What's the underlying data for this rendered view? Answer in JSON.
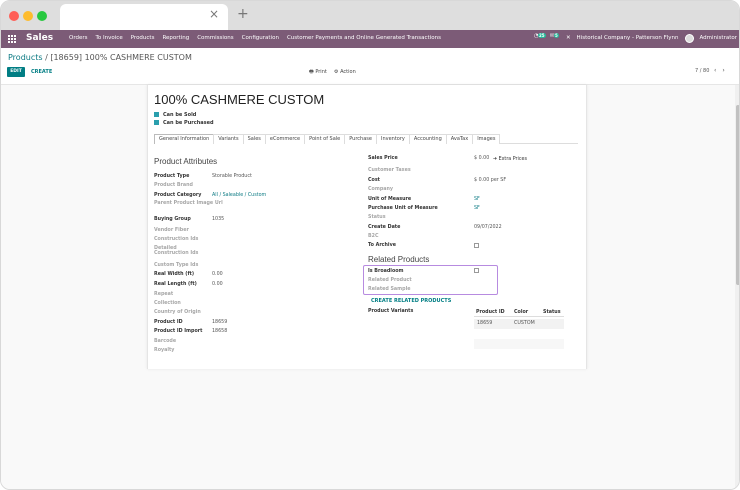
{
  "navbar": {
    "app_name": "Sales",
    "menu": [
      "Orders",
      "To Invoice",
      "Products",
      "Reporting",
      "Commissions",
      "Configuration",
      "Customer Payments and Online Generated Transactions"
    ],
    "activity_badge": "25",
    "messages_badge": "5",
    "company": "Historical Company - Patterson Flynn",
    "user": "Administrator"
  },
  "control": {
    "breadcrumb_root": "Products",
    "breadcrumb_current": "[18659] 100% CASHMERE CUSTOM",
    "edit_label": "EDIT",
    "create_label": "CREATE",
    "print_label": "Print",
    "action_label": "Action",
    "pager": "7 / 80"
  },
  "product": {
    "name": "100% CASHMERE CUSTOM",
    "can_be_sold_label": "Can be Sold",
    "can_be_purchased_label": "Can be Purchased",
    "can_be_sold": true,
    "can_be_purchased": true
  },
  "tabs": [
    "General Information",
    "Variants",
    "Sales",
    "eCommerce",
    "Point of Sale",
    "Purchase",
    "Inventory",
    "Accounting",
    "AvaTax",
    "Images"
  ],
  "left": {
    "section_title": "Product Attributes",
    "fields": [
      {
        "label": "Product Type",
        "value": "Storable Product",
        "muted": false,
        "link": false
      },
      {
        "label": "Product Brand",
        "value": "",
        "muted": true,
        "link": false
      },
      {
        "label": "Product Category",
        "value": "All / Saleable / Custom",
        "muted": false,
        "link": true
      },
      {
        "label": "Parent Product Image Url",
        "value": "",
        "muted": true,
        "link": false
      },
      {
        "label": "Buying Group",
        "value": "1035",
        "muted": false,
        "link": false
      },
      {
        "label": "Vendor Fiber",
        "value": "",
        "muted": true,
        "link": false
      },
      {
        "label": "Construction Ids",
        "value": "",
        "muted": true,
        "link": false
      },
      {
        "label": "Detailed Construction Ids",
        "value": "",
        "muted": true,
        "link": false
      },
      {
        "label": "Custom Type Ids",
        "value": "",
        "muted": true,
        "link": false
      },
      {
        "label": "Real Width (ft)",
        "value": "0.00",
        "muted": false,
        "link": false
      },
      {
        "label": "Real Length (ft)",
        "value": "0.00",
        "muted": false,
        "link": false
      },
      {
        "label": "Repeat",
        "value": "",
        "muted": true,
        "link": false
      },
      {
        "label": "Collection",
        "value": "",
        "muted": true,
        "link": false
      },
      {
        "label": "Country of Origin",
        "value": "",
        "muted": true,
        "link": false
      },
      {
        "label": "Product ID",
        "value": "18659",
        "muted": false,
        "link": false
      },
      {
        "label": "Product ID Import",
        "value": "18658",
        "muted": false,
        "link": false
      },
      {
        "label": "Barcode",
        "value": "",
        "muted": true,
        "link": false
      },
      {
        "label": "Royalty",
        "value": "",
        "muted": true,
        "link": false
      }
    ]
  },
  "right": {
    "sales_price_label": "Sales Price",
    "sales_price": "$ 0.00",
    "extra_prices": "Extra Prices",
    "fields": [
      {
        "label": "Customer Taxes",
        "value": "",
        "muted": true,
        "link": false
      },
      {
        "label": "Cost",
        "value": "$ 0.00 per SF",
        "muted": false,
        "link": false
      },
      {
        "label": "Company",
        "value": "",
        "muted": true,
        "link": false
      },
      {
        "label": "Unit of Measure",
        "value": "SF",
        "muted": false,
        "link": true
      },
      {
        "label": "Purchase Unit of Measure",
        "value": "SF",
        "muted": false,
        "link": true
      },
      {
        "label": "Status",
        "value": "",
        "muted": true,
        "link": false
      },
      {
        "label": "Create Date",
        "value": "09/07/2022",
        "muted": false,
        "link": false
      },
      {
        "label": "B2C",
        "value": "",
        "muted": true,
        "link": false
      },
      {
        "label": "To Archive",
        "value": "",
        "muted": false,
        "link": false
      }
    ],
    "related_title": "Related Products",
    "is_broadloom_label": "Is Broadloom",
    "related_product_label": "Related Product",
    "related_sample_label": "Related Sample",
    "create_related": "CREATE RELATED PRODUCTS",
    "variants_label": "Product Variants",
    "variant_headers": [
      "Product ID",
      "Color",
      "Status"
    ],
    "variant_row": [
      "18659",
      "CUSTOM",
      ""
    ]
  }
}
